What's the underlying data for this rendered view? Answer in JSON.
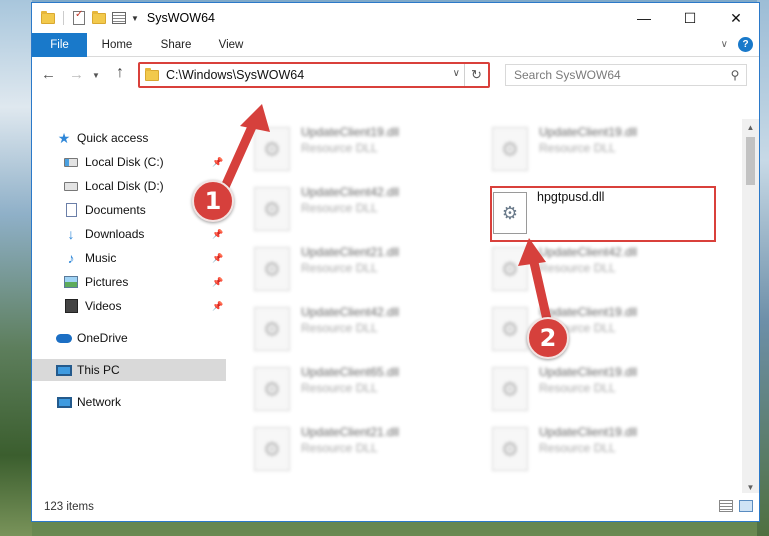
{
  "window": {
    "title": "SysWOW64"
  },
  "window_controls": {
    "minimize": "—",
    "maximize": "☐",
    "close": "✕"
  },
  "ribbon": {
    "tabs": [
      "File",
      "Home",
      "Share",
      "View"
    ],
    "help": "?"
  },
  "address": {
    "path": "C:\\Windows\\SysWOW64",
    "search_placeholder": "Search SysWOW64"
  },
  "nav": {
    "items": [
      {
        "label": "Quick access",
        "icon": "star-icon",
        "pinned": false
      },
      {
        "label": "Local Disk (C:)",
        "icon": "drive-icon",
        "pinned": true
      },
      {
        "label": "Local Disk (D:)",
        "icon": "drive-icon",
        "pinned": false
      },
      {
        "label": "Documents",
        "icon": "documents-icon",
        "pinned": true
      },
      {
        "label": "Downloads",
        "icon": "downloads-icon",
        "pinned": true
      },
      {
        "label": "Music",
        "icon": "music-icon",
        "pinned": true
      },
      {
        "label": "Pictures",
        "icon": "pictures-icon",
        "pinned": true
      },
      {
        "label": "Videos",
        "icon": "videos-icon",
        "pinned": true
      },
      {
        "label": "OneDrive",
        "icon": "onedrive-icon",
        "pinned": false
      },
      {
        "label": "This PC",
        "icon": "this-pc-icon",
        "pinned": false,
        "selected": true
      },
      {
        "label": "Network",
        "icon": "network-icon",
        "pinned": false
      }
    ]
  },
  "files": {
    "left_column": [
      {
        "name": "UpdateClient19.dll",
        "type": "Resource DLL"
      },
      {
        "name": "UpdateClient42.dll",
        "type": "Resource DLL"
      },
      {
        "name": "UpdateClient21.dll",
        "type": "Resource DLL"
      },
      {
        "name": "UpdateClient42.dll",
        "type": "Resource DLL"
      },
      {
        "name": "UpdateClient65.dll",
        "type": "Resource DLL"
      },
      {
        "name": "UpdateClient21.dll",
        "type": "Resource DLL"
      }
    ],
    "right_column": [
      {
        "name": "UpdateClient19.dll",
        "type": "Resource DLL"
      },
      {
        "name": "UpdateClient42.dll",
        "type": "Resource DLL"
      },
      {
        "name": "UpdateClient19.dll",
        "type": "Resource DLL"
      },
      {
        "name": "UpdateClient19.dll",
        "type": "Resource DLL"
      },
      {
        "name": "UpdateClient19.dll",
        "type": "Resource DLL"
      }
    ],
    "highlighted": {
      "name": "hpgtpusd.dll"
    }
  },
  "status": {
    "count": "123 items"
  },
  "annotations": {
    "step1": "1",
    "step2": "2",
    "color": "#d6403c"
  }
}
